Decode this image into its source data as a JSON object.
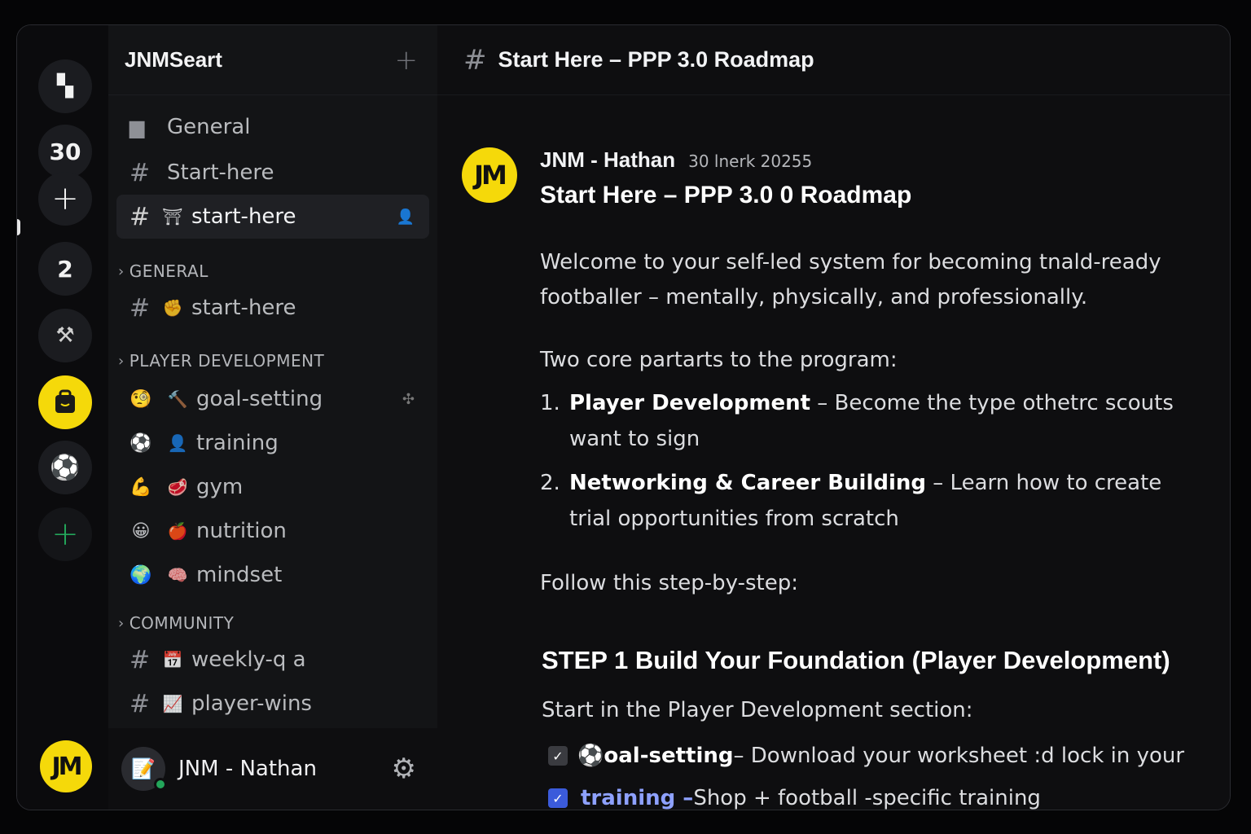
{
  "rail": {
    "servers": [
      {
        "label": "",
        "icon": "server-grid-icon"
      },
      {
        "label": "30",
        "icon": ""
      },
      {
        "label": "+",
        "icon": "add-icon"
      },
      {
        "label": "2",
        "icon": "server-2-icon"
      },
      {
        "label": "",
        "icon": "boot-icon"
      },
      {
        "label": "",
        "icon": "bag-icon"
      },
      {
        "label": "",
        "icon": "football-icon"
      },
      {
        "label": "+",
        "icon": "add-server-icon"
      }
    ],
    "user_avatar": "JM"
  },
  "sidebar": {
    "server_name": "JNMSeart",
    "add_label": "+",
    "top_channels": [
      {
        "label": "General"
      },
      {
        "label": "Start-here"
      },
      {
        "label": "start-here"
      }
    ],
    "categories": {
      "general": "GENERAL",
      "player_development": "PLAYER DEVELOPMENT",
      "community": "COMMUNITY"
    },
    "general_channels": [
      {
        "label": "start-here"
      }
    ],
    "dev_channels": [
      {
        "label": "goal-setting",
        "emoji": "🧐",
        "emoji2": "🔨"
      },
      {
        "label": "training",
        "emoji": "⚽",
        "emoji2": "👤"
      },
      {
        "label": "gym",
        "emoji": "💪",
        "emoji2": "🥩"
      },
      {
        "label": "nutrition",
        "emoji": "😀",
        "emoji2": "🍎"
      },
      {
        "label": "mindset",
        "emoji": "🌍",
        "emoji2": "🧠"
      }
    ],
    "community_channels": [
      {
        "label": "weekly-q a",
        "emoji": "📅"
      },
      {
        "label": "player-wins",
        "emoji": "📈"
      }
    ],
    "user": {
      "name": "JNM - Nathan"
    }
  },
  "main": {
    "channel_title": "Start Here – PPP 3.0 Roadmap",
    "message": {
      "avatar": "JM",
      "author": "JNM - Hathan",
      "timestamp": "30 lnerk 20255",
      "title": "Start Here – PPP 3.0 0 Roadmap",
      "intro": "Welcome to your self-led system for becoming tnald-ready footballer – mentally, physically, and professionally.",
      "parts_heading": "Two core partarts to the program:",
      "parts": [
        {
          "num": "1.",
          "bold": "Player Development",
          "rest": " – Become the type othetrc scouts want to sign"
        },
        {
          "num": "2.",
          "bold": "Networking & Career Building",
          "rest": " – Learn how to create trial opportunities from scratch"
        }
      ],
      "follow": "Follow this step-by-step:",
      "step1": "STEP 1 Build Your Foundation (Player Development)",
      "step1_intro": "Start in the Player Development section:",
      "tasks": [
        {
          "check": "✓",
          "emoji": "⚽",
          "bold": "oal-setting",
          "link": "",
          "rest": " – Download your worksheet :d lock in your"
        },
        {
          "check": "✓",
          "emoji": "",
          "bold": "",
          "link": "training –",
          "rest": " Shop + football -specific training"
        }
      ]
    }
  }
}
